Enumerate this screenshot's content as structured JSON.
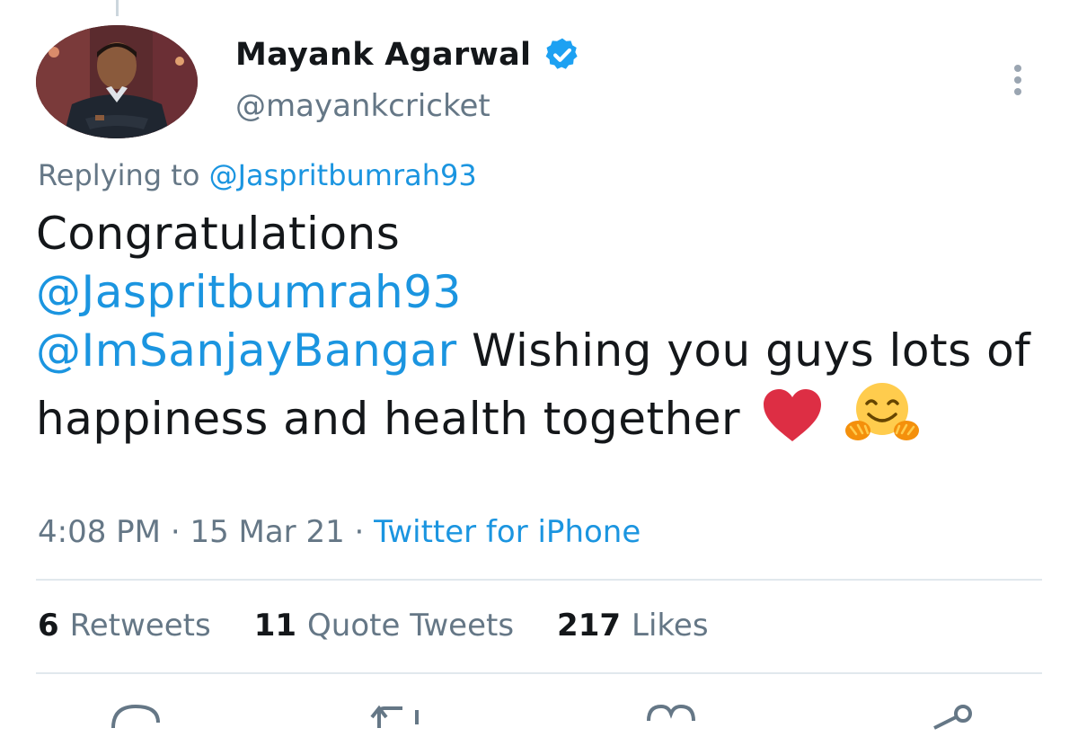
{
  "author": {
    "display_name": "Mayank Agarwal",
    "handle": "@mayankcricket",
    "verified": true
  },
  "reply": {
    "prefix": "Replying to",
    "to": "@Jaspritbumrah93"
  },
  "tweet": {
    "word_1": "Congratulations",
    "mention_1": "@Jaspritbumrah93",
    "mention_2": "@ImSanjayBangar",
    "text_2": "Wishing you guys lots of happiness and health together",
    "emoji_1": "red-heart",
    "emoji_2": "hugging-face"
  },
  "meta": {
    "time": "4:08 PM",
    "date": "15 Mar 21",
    "separator": "·",
    "source": "Twitter for iPhone"
  },
  "stats": [
    {
      "count": "6",
      "label": "Retweets"
    },
    {
      "count": "11",
      "label": "Quote Tweets"
    },
    {
      "count": "217",
      "label": "Likes"
    }
  ],
  "icons": {
    "avatar": "profile-photo",
    "verified": "verified-badge-icon",
    "more": "more-vertical-icon",
    "actions": [
      "reply-icon",
      "retweet-icon",
      "like-icon",
      "share-icon"
    ]
  },
  "colors": {
    "link": "#1b95e0",
    "secondary_text": "#657786",
    "primary_text": "#14171a",
    "verified_badge": "#1da1f2",
    "heart": "#e0245e",
    "divider": "#e1e8ed"
  }
}
